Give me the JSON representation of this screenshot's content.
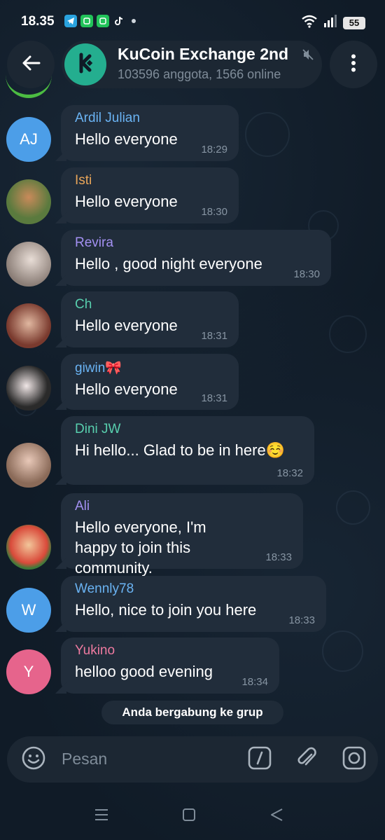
{
  "status": {
    "time": "18.35",
    "battery": "55",
    "apps": [
      {
        "name": "telegram-app-icon",
        "color": "#2aa3df"
      },
      {
        "name": "wechat-app-icon",
        "color": "#22c35a"
      },
      {
        "name": "wechat-app-icon-2",
        "color": "#22c35a"
      },
      {
        "name": "tiktok-app-icon",
        "color": "#111111"
      }
    ]
  },
  "header": {
    "title": "KuCoin Exchange 2nd",
    "subtitle": "103596 anggota, 1566 online",
    "avatar_color": "#24ae8f"
  },
  "messages": [
    {
      "sender": "Ardil Julian",
      "sender_color": "#6ab3f3",
      "text": "Hello everyone",
      "time": "18:29",
      "avatar_initials": "AJ",
      "avatar_color": "#4c9ee8"
    },
    {
      "sender": "Isti",
      "sender_color": "#e9a65a",
      "text": "Hello everyone",
      "time": "18:30",
      "avatar_initials": "",
      "avatar_color": "#5a7a3e"
    },
    {
      "sender": "Revira",
      "sender_color": "#a390f2",
      "text": "Hello , good night everyone",
      "time": "18:30",
      "avatar_initials": "",
      "avatar_color": "#c9c3c0"
    },
    {
      "sender": "Ch",
      "sender_color": "#58cfae",
      "text": "Hello everyone",
      "time": "18:31",
      "avatar_initials": "",
      "avatar_color": "#8a4a3a"
    },
    {
      "sender": "giwin🎀",
      "sender_color": "#6ab3f3",
      "text": "Hello everyone",
      "time": "18:31",
      "avatar_initials": "",
      "avatar_color": "#3a3a3a"
    },
    {
      "sender": "Dini JW",
      "sender_color": "#58cfae",
      "text": "Hi hello... Glad to be in here☺️",
      "time": "18:32",
      "avatar_initials": "",
      "avatar_color": "#b89a88"
    },
    {
      "sender": "Ali",
      "sender_color": "#a390f2",
      "text": "Hello everyone, I'm happy to join this community.",
      "time": "18:33",
      "avatar_initials": "",
      "avatar_color": "#4a8a3a"
    },
    {
      "sender": "Wennly78",
      "sender_color": "#6ab3f3",
      "text": "Hello, nice to join you here",
      "time": "18:33",
      "avatar_initials": "W",
      "avatar_color": "#4c9ee8"
    },
    {
      "sender": "Yukino",
      "sender_color": "#ee7aa0",
      "text": "helloo good evening",
      "time": "18:34",
      "avatar_initials": "Y",
      "avatar_color": "#e6648c"
    }
  ],
  "system_message": "Anda bergabung ke grup",
  "input": {
    "placeholder": "Pesan"
  },
  "colors": {
    "background": "#101b27",
    "bubble": "#212d3b",
    "accent": "#4cbc42"
  }
}
